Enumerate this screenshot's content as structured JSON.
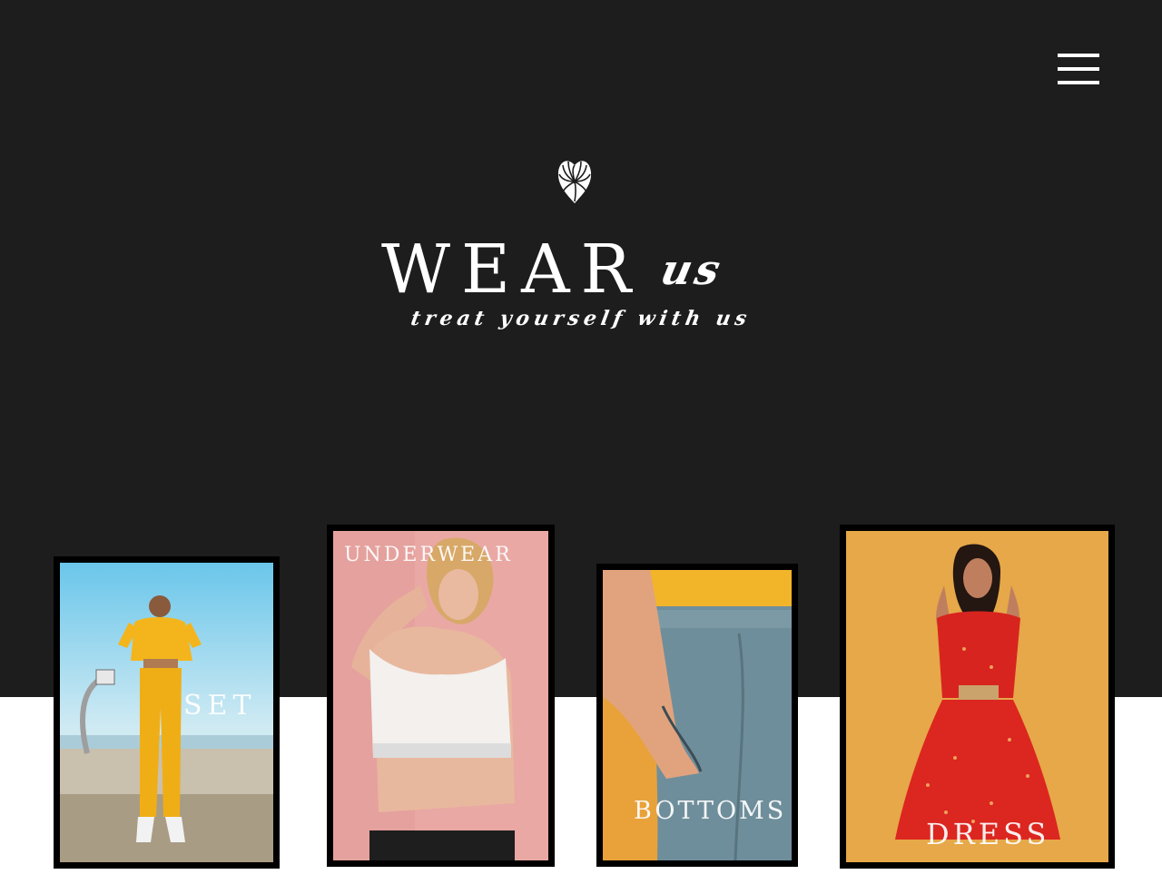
{
  "header": {
    "menu_icon": "hamburger-menu-icon",
    "logo_icon": "swirl-heart-logo-icon",
    "brand_main": "WEAR",
    "brand_script": "us",
    "tagline": "treat yourself with us"
  },
  "categories": [
    {
      "label": "SET",
      "image": "woman-in-yellow-tracksuit-photo"
    },
    {
      "label": "UNDERWEAR",
      "image": "woman-in-white-bralette-photo"
    },
    {
      "label": "BOTTOMS",
      "image": "hand-in-grey-sweatpants-pocket-photo"
    },
    {
      "label": "DRESS",
      "image": "woman-in-red-floral-dress-photo"
    }
  ],
  "colors": {
    "hero_background": "#1d1d1d",
    "page_background": "#ffffff",
    "card_frame": "#000000",
    "text": "#ffffff"
  }
}
